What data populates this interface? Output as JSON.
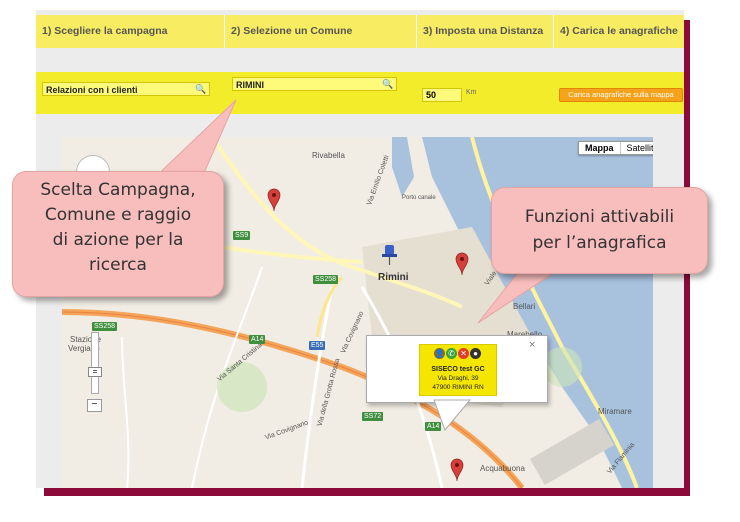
{
  "steps": [
    {
      "label": "1) Scegliere la campagna"
    },
    {
      "label": "2) Selezione un Comune"
    },
    {
      "label": "3) Imposta una Distanza"
    },
    {
      "label": "4) Carica le anagrafiche"
    }
  ],
  "controls": {
    "campaign": "Relazioni con i clienti",
    "comune": "RIMINI",
    "distance": "50",
    "distance_unit": "Km",
    "load_button": "Carica anagrafiche sulla mappa"
  },
  "map": {
    "type_buttons": {
      "map": "Mappa",
      "satellite": "Satellite"
    },
    "labels": {
      "rivabella": "Rivabella",
      "rimini": "Rimini",
      "marebello": "Marebello",
      "miramare": "Miramare",
      "acquabuona": "Acquabuona",
      "bellariva": "Bellari",
      "stazione": "Stazione",
      "vergiano": "Vergiano",
      "porto": "Porto canale",
      "via_coletti": "Via Emilio Coletti",
      "viale_regina": "Viale Regina Elena",
      "via_covignano": "Via Covignano",
      "via_santa_cristina": "Via Santa Cristina",
      "via_grotta_rossa": "Via della Grotta Rossa",
      "via_flaminia": "Via Flaminia",
      "via_covignano2": "Via Covignano"
    },
    "signs": {
      "ss9": "SS9",
      "ss258": "SS258",
      "ss258b": "SS258",
      "a14": "A14",
      "e55": "E55",
      "sp": "SP",
      "ss72": "SS72",
      "a14b": "A14"
    },
    "zoom": {
      "plus": "+",
      "minus": "−"
    }
  },
  "info_window": {
    "close": "×",
    "name": "SISECO test GC",
    "address1": "Via Draghi, 39",
    "address2": "47900 RIMINI RN"
  },
  "callouts": {
    "left": [
      "Scelta Campagna,",
      "Comune e raggio",
      "di azione per la",
      "ricerca"
    ],
    "right": [
      "Funzioni attivabili",
      "per l’anagrafica"
    ]
  },
  "colors": {
    "steps_bar": "#f7ec62",
    "controls_bar": "#f2ec2a",
    "frame_shadow": "#8b0a3a",
    "callout": "#f8bdbd",
    "load_button": "#f7a21b"
  }
}
